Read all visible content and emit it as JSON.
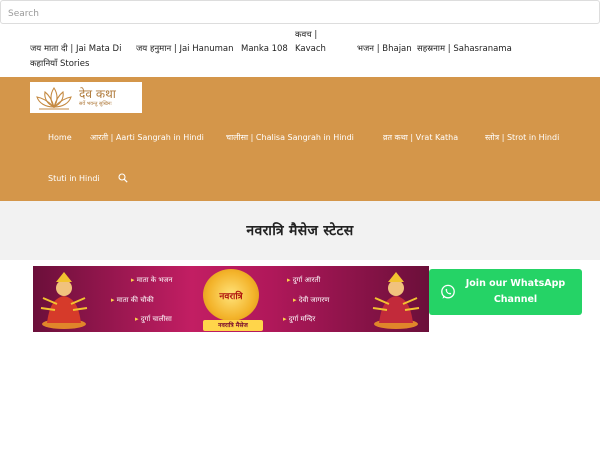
{
  "search": {
    "placeholder": "Search"
  },
  "top_menu": [
    {
      "label": "जय माता दी | Jai Mata Di"
    },
    {
      "label": "जय हनुमान | Jai Hanuman"
    },
    {
      "label": "Manka 108"
    },
    {
      "label": "कवच |"
    },
    {
      "label": "Kavach"
    },
    {
      "label": "भजन | Bhajan"
    },
    {
      "label": "सहस्रनाम | Sahasranama"
    },
    {
      "label": "कहानियाँ Stories"
    }
  ],
  "logo": {
    "title": "देव कथा",
    "tagline": "सर्वे भवन्तु सुखिनः"
  },
  "nav": {
    "items": [
      {
        "label": "Home"
      },
      {
        "label": "आरती | Aarti Sangrah in Hindi"
      },
      {
        "label": "चालीसा | Chalisa Sangrah in Hindi"
      },
      {
        "label": "व्रत कथा | Vrat Katha"
      },
      {
        "label": "स्तोत्र | Strot in Hindi"
      },
      {
        "label": "Stuti in Hindi"
      }
    ],
    "search_icon": "search-icon"
  },
  "page": {
    "title": "नवरात्रि मैसेज स्टेटस"
  },
  "banner": {
    "links": [
      "माता के भजन",
      "माता की चौकी",
      "दुर्गा चालीसा",
      "दुर्गा आरती",
      "देवी जागरण",
      "दुर्गा मन्दिर"
    ],
    "emblem_text": "नवरात्रि",
    "ribbon_text": "नवरात्रि मैसेज"
  },
  "whatsapp": {
    "label": "Join our WhatsApp Channel",
    "icon": "whatsapp-icon",
    "color": "#25d366"
  },
  "colors": {
    "header_bg": "#d4964a",
    "title_bar_bg": "#f2f2f2"
  }
}
